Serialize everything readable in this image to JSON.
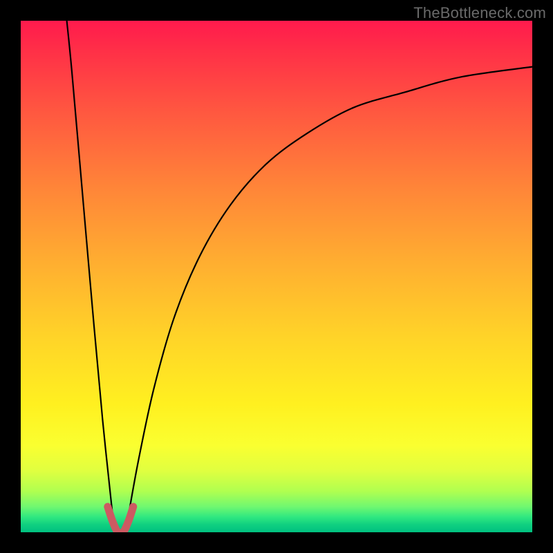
{
  "watermark": "TheBottleneck.com",
  "chart_data": {
    "type": "line",
    "title": "",
    "xlabel": "",
    "ylabel": "",
    "xlim": [
      0,
      100
    ],
    "ylim": [
      0,
      100
    ],
    "grid": false,
    "legend": false,
    "series": [
      {
        "name": "left-descent",
        "x": [
          9,
          10,
          12,
          14,
          16,
          18
        ],
        "values": [
          100,
          90,
          67,
          44,
          22,
          3
        ]
      },
      {
        "name": "right-ascent",
        "x": [
          21,
          23,
          26,
          30,
          35,
          41,
          48,
          56,
          65,
          75,
          86,
          100
        ],
        "values": [
          3,
          14,
          28,
          42,
          54,
          64,
          72,
          78,
          83,
          86,
          89,
          91
        ]
      },
      {
        "name": "dip-marker",
        "x": [
          17,
          18,
          19,
          20,
          21,
          22
        ],
        "values": [
          5,
          2,
          0,
          0,
          2,
          5
        ]
      }
    ],
    "gradient_stops": [
      {
        "pos": 0,
        "color": "#ff1a4d"
      },
      {
        "pos": 50,
        "color": "#ffc028"
      },
      {
        "pos": 85,
        "color": "#f5ff30"
      },
      {
        "pos": 100,
        "color": "#00c080"
      }
    ]
  }
}
